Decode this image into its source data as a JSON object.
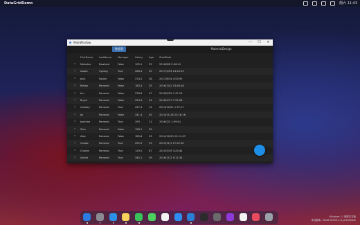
{
  "menubar": {
    "app_name": "DataGridDemo",
    "clock": "周六 11:43"
  },
  "window": {
    "title": "MainWindow",
    "controls": {
      "minimize": "—",
      "maximize": "☐",
      "close": "✕"
    }
  },
  "tabs": [
    {
      "label": "数据表",
      "active": true
    },
    {
      "label": "MaterialDesign",
      "active": false
    }
  ],
  "grid": {
    "columns": [
      "FirstName",
      "LastName",
      "Manager",
      "Salary",
      "Age",
      "StartDate"
    ],
    "rows": [
      [
        "Nicholas",
        "Rowland",
        "False",
        "105.1",
        "52",
        "2016/8/8 5:56:41"
      ],
      [
        "Isaiah",
        "Vyberg",
        "True",
        "286.4",
        "49",
        "2017/2/23 14:43:25"
      ],
      [
        "Jack",
        "Faulkn",
        "False",
        "374.2",
        "38",
        "2017/8/14 4:53:59"
      ],
      [
        "Rohan",
        "Pomeroi",
        "False",
        "183.3",
        "35",
        "2016/10/1 13:40:28"
      ],
      [
        "Iori",
        "Pomeroi",
        "False",
        "378.6",
        "47",
        "2016/2/29 7:47:13"
      ],
      [
        "Bryce",
        "Pomeroi",
        "False",
        "453.4",
        "54",
        "2016/2/17 7:25:08"
      ],
      [
        "Lindsey",
        "Pomeroi",
        "True",
        "437.4",
        "13",
        "2013/10/21 1:37:17"
      ],
      [
        "Jai",
        "Pomeroi",
        "False",
        "341.4",
        "45",
        "2014/11/16 23:18:16"
      ],
      [
        "Jasmine",
        "Pomeroi",
        "True",
        "293",
        "21",
        "2016/2/2 1:59:01"
      ],
      [
        "Shin",
        "Pomeroi",
        "False",
        "158.1",
        "35",
        ""
      ],
      [
        "Alex",
        "Pomeroi",
        "False",
        "185.8",
        "43",
        "2014/10/20 22:11:47"
      ],
      [
        "Cassie",
        "Pomeroi",
        "True",
        "292.5",
        "53",
        "2015/11/1 17:22:30"
      ],
      [
        "Charlie",
        "Pomeroi",
        "True",
        "129.2",
        "67",
        "2015/5/19 3:23:44"
      ],
      [
        "Archie",
        "Pomeroi",
        "True",
        "345.1",
        "39",
        "2016/11/2 9:11:33"
      ]
    ]
  },
  "os_info": {
    "line1": "Windows 11 家庭中文版",
    "line2": "评估副本。Build 22000.1.rs_prerelease"
  },
  "dock": {
    "icons": [
      "finder-icon",
      "launchpad-icon",
      "safari-icon",
      "notes-icon",
      "wechat-icon",
      "messages-icon",
      "calendar-icon",
      "appstore-icon",
      "vscode-icon",
      "terminal-icon",
      "camera-icon",
      "rider-icon",
      "github-icon",
      "photos-icon",
      "trash-icon"
    ],
    "colors": [
      "#2d7be0",
      "#8a8a92",
      "#2d8fe8",
      "#f5d35a",
      "#3ac25a",
      "#4ccf5e",
      "#f2f2f2",
      "#2f8cf0",
      "#2a7fd4",
      "#2b2b2b",
      "#6a6a6a",
      "#8f3ad8",
      "#f2f2f2",
      "#e84a5e",
      "#9aa0a8"
    ]
  }
}
